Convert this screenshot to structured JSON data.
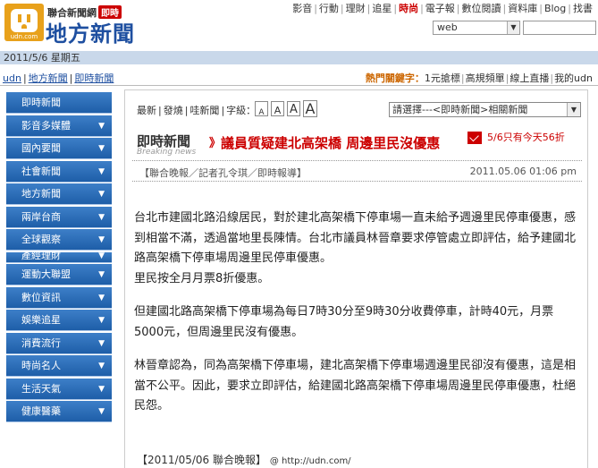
{
  "header": {
    "logo_brand": "聯合新聞網",
    "logo_badge": "即時",
    "logo_site": "udn.com",
    "logo_title": "地方新聞",
    "topnav": [
      "影音",
      "行動",
      "理財",
      "追星",
      "時尚",
      "電子報",
      "數位閱讀",
      "資料庫",
      "Blog",
      "找書"
    ],
    "topnav_hot": "時尚",
    "search_scope": "web"
  },
  "datebar": {
    "date": "2011/5/6 星期五"
  },
  "breadcrumb": [
    "udn",
    "地方新聞",
    "即時新聞"
  ],
  "hotkeys": {
    "label": "熱門關鍵字：",
    "items": [
      "1元搶標",
      "高規頻單",
      "線上直播",
      "我的udn"
    ]
  },
  "sidebar": {
    "items": [
      {
        "label": "即時新聞",
        "chev": false
      },
      {
        "label": "影音多媒體",
        "chev": true
      },
      {
        "label": "國內要聞",
        "chev": true
      },
      {
        "label": "社會新聞",
        "chev": true
      },
      {
        "label": "地方新聞",
        "chev": true
      },
      {
        "label": "兩岸台商",
        "chev": true
      },
      {
        "label": "全球觀察",
        "chev": true
      },
      {
        "label": "產經理財",
        "chev": true
      },
      {
        "label": "運動大聯盟",
        "chev": true
      },
      {
        "label": "數位資訊",
        "chev": true
      },
      {
        "label": "娛樂追星",
        "chev": true
      },
      {
        "label": "消費流行",
        "chev": true
      },
      {
        "label": "時尚名人",
        "chev": true
      },
      {
        "label": "生活天氣",
        "chev": true
      },
      {
        "label": "健康醫藥",
        "chev": true
      }
    ]
  },
  "toolbar": {
    "items": [
      "最新",
      "發燒",
      "哇新聞",
      "字級："
    ],
    "font_sizes": [
      "A",
      "A",
      "A",
      "A"
    ],
    "topic_select": "請選擇---<即時新聞>相關新聞"
  },
  "article": {
    "section": "即時新聞",
    "section_sub": "Breaking news",
    "arrows": "》",
    "headline": "議員質疑建北高架橋 周邊里民沒優惠",
    "promo": "5/6只有今天56折",
    "source": "【聯合晚報／記者孔令琪／即時報導】",
    "timestamp": "2011.05.06 01:06 pm",
    "paragraphs": [
      "台北市建國北路沿線居民，對於建北高架橋下停車場一直未給予週邊里民停車優惠，感到相當不滿，透過當地里長陳情。台北市議員林晉章要求停管處立即評估，給予建國北路高架橋下停車場周邊里民停車優惠。",
      "里民按全月月票8折優惠。",
      "但建國北路高架橋下停車場為每日7時30分至9時30分收費停車，計時40元，月票5000元，但周邊里民沒有優惠。",
      "林晉章認為，同為高架橋下停車場，建北高架橋下停車場週邊里民卻沒有優惠，這是相當不公平。因此，要求立即評估，給建國北路高架橋下停車場周邊里民停車優惠，杜絕民怨。"
    ],
    "footer": "【2011/05/06 聯合晚報】",
    "footer_url": "@ http://udn.com/"
  }
}
